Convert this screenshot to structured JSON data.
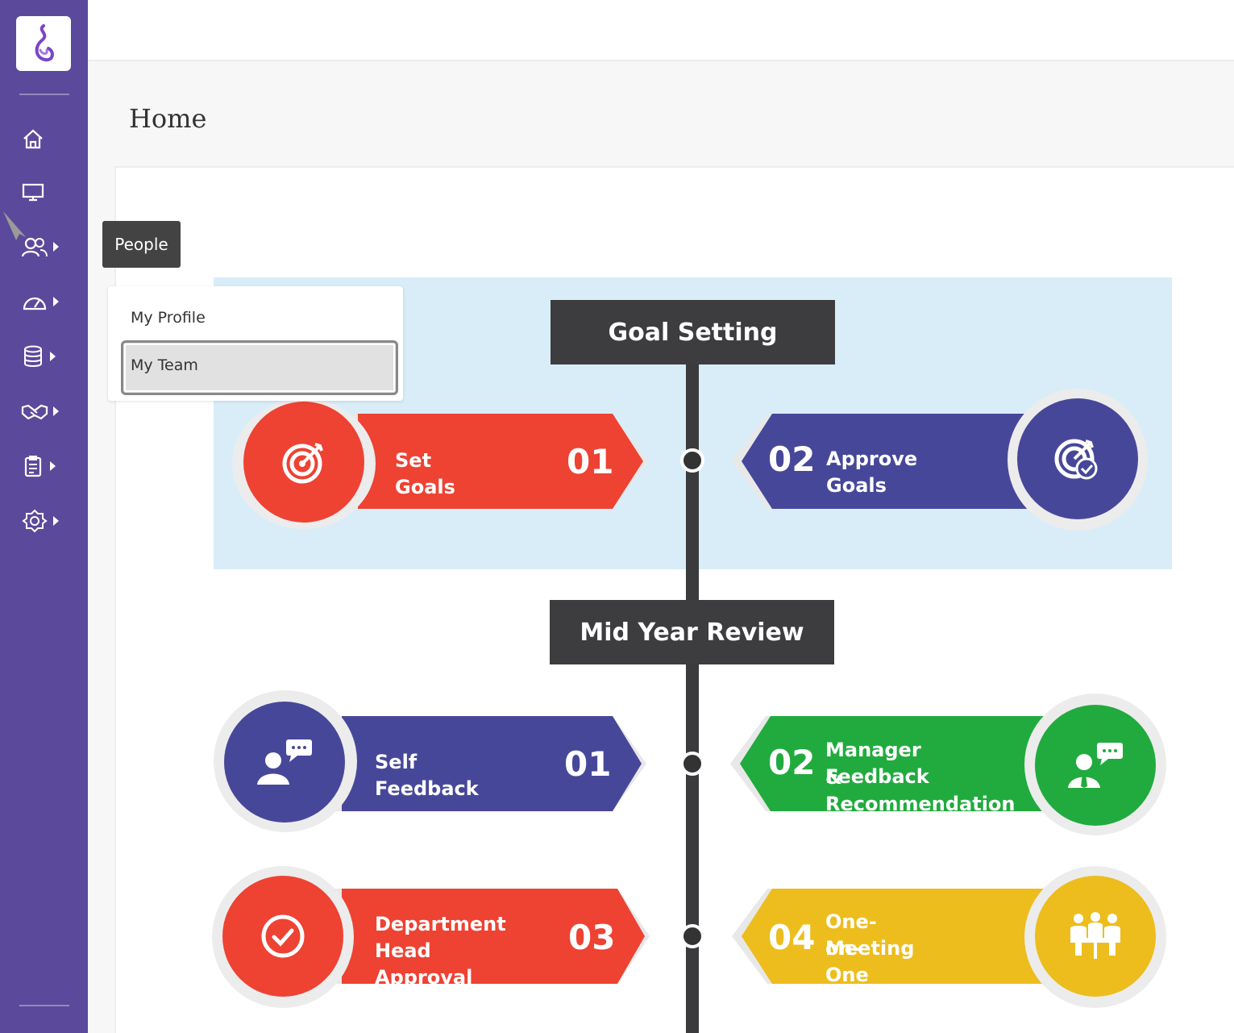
{
  "header": {
    "title": "Home"
  },
  "sidebar": {
    "logo": "app-logo",
    "items": [
      {
        "icon": "home-icon"
      },
      {
        "icon": "monitor-icon"
      },
      {
        "icon": "people-icon",
        "tooltip": "People"
      },
      {
        "icon": "speedometer-icon"
      },
      {
        "icon": "database-icon"
      },
      {
        "icon": "handshake-icon"
      },
      {
        "icon": "clipboard-icon"
      },
      {
        "icon": "settings-icon"
      }
    ]
  },
  "submenu": {
    "items": [
      "My Profile",
      "My Team"
    ],
    "active": "My Team"
  },
  "sections": [
    {
      "title": "Goal Setting",
      "steps": [
        {
          "number": "01",
          "label": "Set Goals",
          "color": "#ee4233",
          "icon": "target-icon"
        },
        {
          "number": "02",
          "label": "Approve Goals",
          "color": "#47479a",
          "icon": "target-check-icon"
        }
      ]
    },
    {
      "title": "Mid Year Review",
      "steps": [
        {
          "number": "01",
          "label": "Self Feedback",
          "color": "#47479a",
          "icon": "user-chat-icon"
        },
        {
          "number": "02",
          "label_line1": "Manager Feedback",
          "label_line2": "& Recommendation",
          "color": "#21ab3e",
          "icon": "manager-chat-icon"
        },
        {
          "number": "03",
          "label_line1": "Department",
          "label_line2": "Head Approval",
          "color": "#ee4233",
          "icon": "check-circle-icon"
        },
        {
          "number": "04",
          "label_line1": "One-on-One",
          "label_line2": "Meeting",
          "color": "#ecbd1d",
          "icon": "meeting-icon"
        }
      ]
    }
  ]
}
